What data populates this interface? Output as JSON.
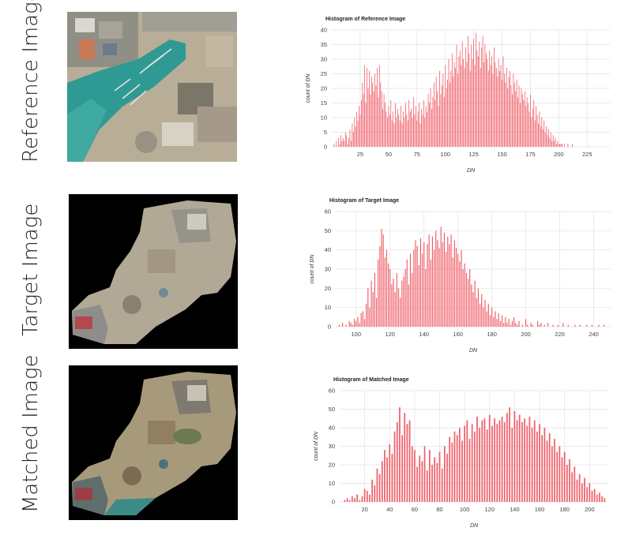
{
  "rows": [
    {
      "label": "Reference Image"
    },
    {
      "label": "Target Image"
    },
    {
      "label": "Matched Image"
    }
  ],
  "colors": {
    "bar": "#f0606a",
    "grid": "#e2e2e2",
    "water": "#2f9a93",
    "ground": "#b8ad97",
    "background_black": "#000000"
  },
  "chart_data": [
    {
      "type": "bar",
      "title": "Histogram of Reference Image",
      "xlabel": "DN",
      "ylabel": "count of DN",
      "xlim": [
        0,
        245
      ],
      "ylim": [
        0,
        40
      ],
      "xticks": [
        25,
        50,
        75,
        100,
        125,
        150,
        175,
        200,
        225
      ],
      "yticks": [
        0,
        5,
        10,
        15,
        20,
        25,
        30,
        35,
        40
      ],
      "grid": true,
      "x": [
        2,
        3,
        4,
        5,
        6,
        7,
        8,
        9,
        10,
        11,
        12,
        13,
        14,
        15,
        16,
        17,
        18,
        19,
        20,
        21,
        22,
        23,
        24,
        25,
        26,
        27,
        28,
        29,
        30,
        31,
        32,
        33,
        34,
        35,
        36,
        37,
        38,
        39,
        40,
        41,
        42,
        43,
        44,
        45,
        46,
        47,
        48,
        49,
        50,
        51,
        52,
        53,
        54,
        55,
        56,
        57,
        58,
        59,
        60,
        61,
        62,
        63,
        64,
        65,
        66,
        67,
        68,
        69,
        70,
        71,
        72,
        73,
        74,
        75,
        76,
        77,
        78,
        79,
        80,
        81,
        82,
        83,
        84,
        85,
        86,
        87,
        88,
        89,
        90,
        91,
        92,
        93,
        94,
        95,
        96,
        97,
        98,
        99,
        100,
        101,
        102,
        103,
        104,
        105,
        106,
        107,
        108,
        109,
        110,
        111,
        112,
        113,
        114,
        115,
        116,
        117,
        118,
        119,
        120,
        121,
        122,
        123,
        124,
        125,
        126,
        127,
        128,
        129,
        130,
        131,
        132,
        133,
        134,
        135,
        136,
        137,
        138,
        139,
        140,
        141,
        142,
        143,
        144,
        145,
        146,
        147,
        148,
        149,
        150,
        151,
        152,
        153,
        154,
        155,
        156,
        157,
        158,
        159,
        160,
        161,
        162,
        163,
        164,
        165,
        166,
        167,
        168,
        169,
        170,
        171,
        172,
        173,
        174,
        175,
        176,
        177,
        178,
        179,
        180,
        181,
        182,
        183,
        184,
        185,
        186,
        187,
        188,
        189,
        190,
        191,
        192,
        193,
        194,
        195,
        196,
        197,
        198,
        199,
        200,
        201,
        202,
        203,
        204,
        205,
        206,
        207,
        208,
        209,
        210,
        211,
        212
      ],
      "values": [
        1,
        0,
        2,
        0,
        3,
        1,
        4,
        2,
        3,
        2,
        5,
        4,
        1,
        3,
        6,
        2,
        8,
        5,
        10,
        7,
        12,
        9,
        14,
        11,
        16,
        22,
        18,
        28,
        15,
        27,
        20,
        26,
        18,
        24,
        22,
        19,
        25,
        21,
        27,
        17,
        28,
        22,
        19,
        13,
        18,
        15,
        12,
        10,
        14,
        11,
        16,
        9,
        12,
        8,
        15,
        10,
        13,
        11,
        9,
        14,
        8,
        12,
        10,
        15,
        11,
        9,
        16,
        12,
        13,
        10,
        17,
        11,
        14,
        9,
        12,
        15,
        8,
        13,
        11,
        16,
        10,
        14,
        12,
        18,
        15,
        20,
        13,
        17,
        22,
        16,
        24,
        19,
        14,
        26,
        18,
        21,
        25,
        17,
        28,
        20,
        23,
        30,
        22,
        26,
        32,
        24,
        29,
        27,
        35,
        25,
        31,
        33,
        28,
        36,
        30,
        27,
        34,
        29,
        38,
        32,
        26,
        35,
        30,
        37,
        28,
        39,
        33,
        31,
        36,
        27,
        34,
        38,
        29,
        35,
        32,
        30,
        26,
        33,
        28,
        31,
        25,
        34,
        29,
        27,
        24,
        30,
        26,
        28,
        23,
        31,
        25,
        22,
        27,
        20,
        24,
        26,
        21,
        18,
        25,
        22,
        19,
        23,
        17,
        21,
        15,
        20,
        18,
        16,
        19,
        14,
        17,
        15,
        12,
        18,
        10,
        13,
        16,
        9,
        14,
        11,
        8,
        12,
        7,
        10,
        6,
        9,
        5,
        7,
        4,
        6,
        3,
        5,
        2,
        4,
        2,
        3,
        1,
        2,
        1,
        1,
        1,
        1,
        0,
        1,
        0,
        0,
        1,
        0,
        0,
        0,
        1
      ]
    },
    {
      "type": "bar",
      "title": "Histogram of Target Image",
      "xlabel": "DN",
      "ylabel": "count of DN",
      "xlim": [
        88,
        250
      ],
      "ylim": [
        0,
        60
      ],
      "xticks": [
        100,
        120,
        140,
        160,
        180,
        200,
        220,
        240
      ],
      "yticks": [
        0,
        10,
        20,
        30,
        40,
        50,
        60
      ],
      "grid": true,
      "x": [
        90,
        91,
        92,
        93,
        94,
        95,
        96,
        97,
        98,
        99,
        100,
        101,
        102,
        103,
        104,
        105,
        106,
        107,
        108,
        109,
        110,
        111,
        112,
        113,
        114,
        115,
        116,
        117,
        118,
        119,
        120,
        121,
        122,
        123,
        124,
        125,
        126,
        127,
        128,
        129,
        130,
        131,
        132,
        133,
        134,
        135,
        136,
        137,
        138,
        139,
        140,
        141,
        142,
        143,
        144,
        145,
        146,
        147,
        148,
        149,
        150,
        151,
        152,
        153,
        154,
        155,
        156,
        157,
        158,
        159,
        160,
        161,
        162,
        163,
        164,
        165,
        166,
        167,
        168,
        169,
        170,
        171,
        172,
        173,
        174,
        175,
        176,
        177,
        178,
        179,
        180,
        181,
        182,
        183,
        184,
        185,
        186,
        187,
        188,
        189,
        190,
        191,
        192,
        193,
        194,
        195,
        196,
        197,
        198,
        199,
        200,
        201,
        202,
        203,
        204,
        205,
        206,
        207,
        208,
        209,
        210,
        211,
        212,
        213,
        214,
        215,
        216,
        217,
        218,
        219,
        220,
        221,
        222,
        223,
        224,
        225,
        226,
        227,
        228,
        229,
        230,
        231,
        232,
        233,
        234,
        235,
        236,
        237,
        238,
        239,
        240,
        241,
        242,
        243,
        244,
        245,
        246,
        247,
        248
      ],
      "values": [
        1,
        0,
        2,
        0,
        1,
        0,
        3,
        2,
        1,
        4,
        3,
        5,
        2,
        7,
        8,
        4,
        12,
        20,
        10,
        24,
        18,
        28,
        15,
        35,
        42,
        51,
        48,
        36,
        40,
        33,
        30,
        22,
        25,
        18,
        28,
        20,
        15,
        24,
        26,
        30,
        35,
        22,
        38,
        28,
        40,
        45,
        42,
        32,
        46,
        38,
        44,
        30,
        43,
        48,
        35,
        47,
        40,
        50,
        45,
        41,
        52,
        44,
        49,
        39,
        47,
        43,
        48,
        36,
        45,
        41,
        38,
        34,
        40,
        30,
        33,
        28,
        25,
        30,
        22,
        18,
        24,
        15,
        20,
        12,
        17,
        10,
        14,
        8,
        12,
        6,
        10,
        5,
        8,
        4,
        7,
        3,
        6,
        2,
        5,
        2,
        4,
        1,
        3,
        5,
        2,
        1,
        3,
        0,
        1,
        0,
        4,
        1,
        0,
        2,
        1,
        0,
        0,
        3,
        1,
        2,
        0,
        1,
        0,
        2,
        0,
        0,
        1,
        0,
        0,
        1,
        0,
        0,
        2,
        0,
        0,
        1,
        0,
        0,
        0,
        1,
        0,
        0,
        1,
        0,
        0,
        0,
        1,
        0,
        0,
        1,
        0,
        0,
        0,
        1,
        0,
        0,
        1,
        0,
        0
      ]
    },
    {
      "type": "bar",
      "title": "Histogram of Matched Image",
      "xlabel": "DN",
      "ylabel": "count of DN",
      "xlim": [
        0,
        215
      ],
      "ylim": [
        0,
        60
      ],
      "xticks": [
        20,
        40,
        60,
        80,
        100,
        120,
        140,
        160,
        180,
        200
      ],
      "yticks": [
        0,
        10,
        20,
        30,
        40,
        50,
        60
      ],
      "grid": true,
      "x": [
        4,
        6,
        8,
        10,
        12,
        14,
        16,
        18,
        20,
        22,
        24,
        26,
        28,
        30,
        32,
        34,
        36,
        38,
        40,
        42,
        44,
        46,
        48,
        50,
        52,
        54,
        56,
        58,
        60,
        62,
        64,
        66,
        68,
        70,
        72,
        74,
        76,
        78,
        80,
        82,
        84,
        86,
        88,
        90,
        92,
        94,
        96,
        98,
        100,
        102,
        104,
        106,
        108,
        110,
        112,
        114,
        116,
        118,
        120,
        122,
        124,
        126,
        128,
        130,
        132,
        134,
        136,
        138,
        140,
        142,
        144,
        146,
        148,
        150,
        152,
        154,
        156,
        158,
        160,
        162,
        164,
        166,
        168,
        170,
        172,
        174,
        176,
        178,
        180,
        182,
        184,
        186,
        188,
        190,
        192,
        194,
        196,
        198,
        200,
        202,
        204,
        206,
        208,
        210,
        212
      ],
      "values": [
        1,
        2,
        1,
        3,
        2,
        4,
        1,
        3,
        7,
        6,
        4,
        12,
        9,
        18,
        15,
        22,
        28,
        24,
        31,
        26,
        38,
        43,
        51,
        36,
        48,
        42,
        44,
        30,
        28,
        19,
        25,
        22,
        30,
        17,
        28,
        20,
        24,
        21,
        27,
        18,
        30,
        26,
        35,
        32,
        38,
        36,
        40,
        33,
        41,
        44,
        34,
        42,
        38,
        46,
        40,
        44,
        45,
        39,
        47,
        41,
        45,
        42,
        44,
        46,
        43,
        48,
        51,
        40,
        49,
        44,
        47,
        43,
        45,
        41,
        46,
        40,
        44,
        38,
        42,
        36,
        40,
        33,
        37,
        30,
        34,
        27,
        30,
        24,
        27,
        20,
        23,
        16,
        19,
        12,
        15,
        10,
        13,
        8,
        10,
        6,
        7,
        4,
        5,
        3,
        2
      ]
    }
  ]
}
